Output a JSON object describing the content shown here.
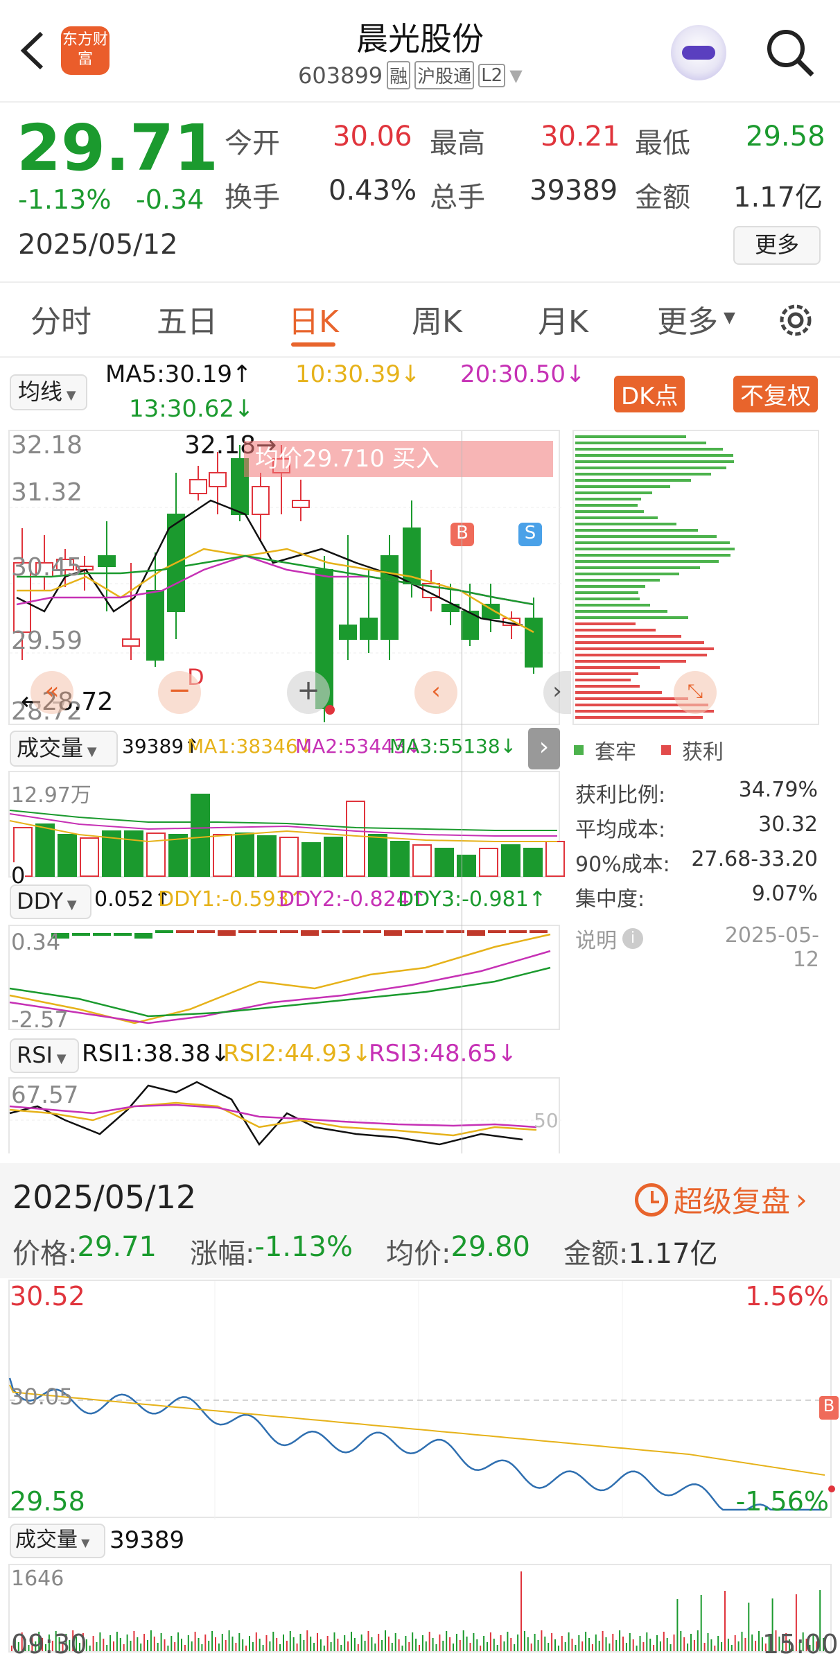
{
  "header": {
    "title": "晨光股份",
    "code": "603899",
    "badges": [
      "融",
      "沪股通",
      "L2"
    ],
    "logo": "东方财富"
  },
  "quote": {
    "price": "29.71",
    "pct": "-1.13%",
    "chg": "-0.34",
    "date": "2025/05/12",
    "stats": [
      {
        "label": "今开",
        "value": "30.06",
        "color": "red"
      },
      {
        "label": "最高",
        "value": "30.21",
        "color": "red"
      },
      {
        "label": "最低",
        "value": "29.58",
        "color": "green"
      },
      {
        "label": "换手",
        "value": "0.43%",
        "color": "dark"
      },
      {
        "label": "总手",
        "value": "39389",
        "color": "dark"
      },
      {
        "label": "金额",
        "value": "1.17亿",
        "color": "dark"
      }
    ],
    "more": "更多"
  },
  "tabs": [
    "分时",
    "五日",
    "日K",
    "周K",
    "月K",
    "更多"
  ],
  "active_tab": "日K",
  "ma": {
    "selector": "均线",
    "ma5": "MA5:30.19↑",
    "ma10": "10:30.39↓",
    "ma20": "20:30.50↓",
    "ma13": "13:30.62↓",
    "dk": "DK点",
    "fq": "不复权"
  },
  "kchart": {
    "ylabels": [
      "32.18",
      "31.32",
      "30.45",
      "29.59",
      "28.72"
    ],
    "high_mark": "32.18",
    "low_mark": "28.72",
    "avg_banner": "均价29.710  买入",
    "d_mark": "D",
    "b_mark": "B",
    "s_mark": "S"
  },
  "chip": {
    "legend_locked": "套牢",
    "legend_profit": "获利",
    "rows": [
      {
        "label": "获利比例:",
        "value": "34.79%"
      },
      {
        "label": "平均成本:",
        "value": "30.32"
      },
      {
        "label": "90%成本:",
        "value": "27.68-33.20"
      },
      {
        "label": "集中度:",
        "value": "9.07%"
      }
    ],
    "note": "说明",
    "note_date": "2025-05-12"
  },
  "volume": {
    "selector": "成交量",
    "val": "39389↑",
    "ma1": "MA1:38346↓",
    "ma2": "MA2:53443↓",
    "ma3": "MA3:55138↓",
    "max": "12.97万",
    "zero": "0"
  },
  "ddy": {
    "selector": "DDY",
    "val": "0.052↑",
    "ddy1": "DDY1:-0.593↑",
    "ddy2": "DDY2:-0.824↑",
    "ddy3": "DDY3:-0.981↑",
    "top": "0.34",
    "bottom": "-2.57"
  },
  "rsi": {
    "selector": "RSI",
    "rsi1": "RSI1:38.38↓",
    "rsi2": "RSI2:44.93↓",
    "rsi3": "RSI3:48.65↓",
    "top": "67.57",
    "mid": "50"
  },
  "intraday": {
    "date": "2025/05/12",
    "replay": "超级复盘",
    "price_label": "价格:",
    "price": "29.71",
    "chg_label": "涨幅:",
    "chg": "-1.13%",
    "avg_label": "均价:",
    "avg": "29.80",
    "amt_label": "金额:",
    "amt": "1.17亿",
    "top": "30.52",
    "top_pct": "1.56%",
    "mid": "30.05",
    "bottom": "29.58",
    "bottom_pct": "-1.56%",
    "b_mark": "B",
    "vol_selector": "成交量",
    "vol_val": "39389",
    "vol_max": "1646",
    "t_start": "09:30",
    "t_end": "15:00"
  },
  "colors": {
    "up": "#e0343c",
    "down": "#1b9a2e",
    "accent": "#e8642c",
    "ma5": "#111111",
    "ma10": "#e6b21a",
    "ma20": "#c631b5",
    "ma13": "#1b9a2e"
  }
}
